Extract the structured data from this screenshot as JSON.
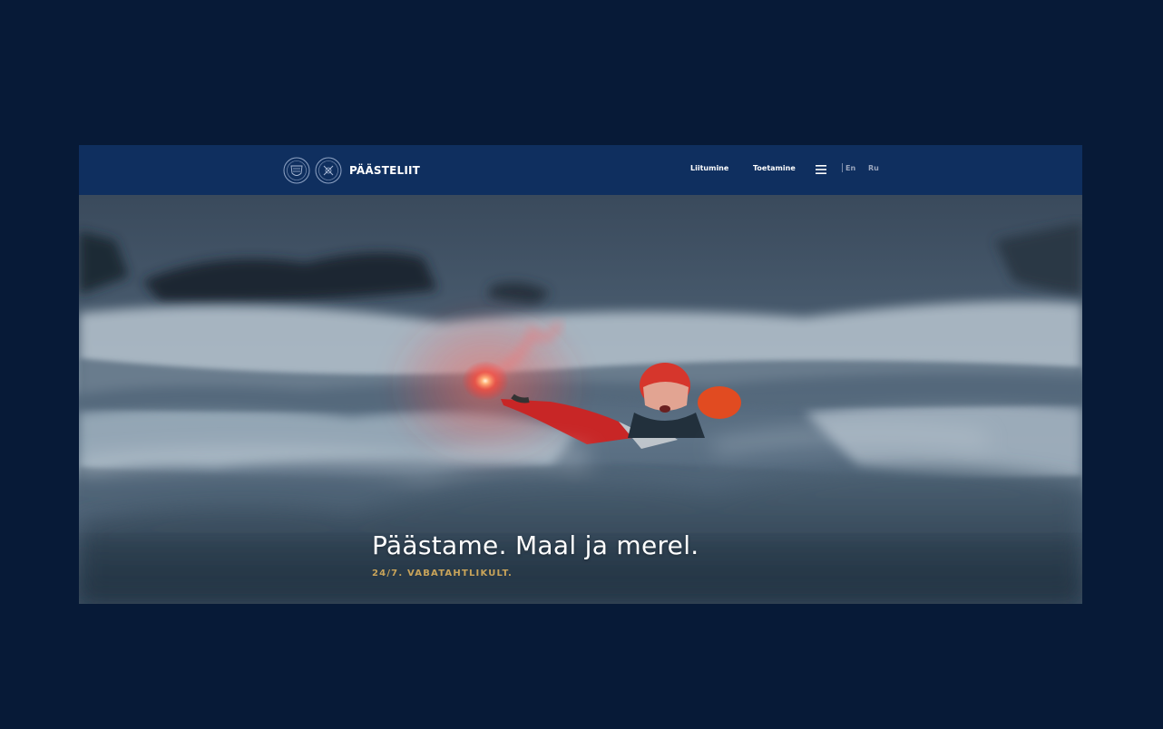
{
  "header": {
    "brand": "PÄÄSTELIIT",
    "nav": [
      {
        "label": "Liitumine"
      },
      {
        "label": "Toetamine"
      }
    ],
    "menu_icon": "hamburger-menu-icon",
    "languages": [
      "En",
      "Ru"
    ]
  },
  "hero": {
    "title": "Päästame. Maal ja merel.",
    "subtitle": "24/7. VABATAHTLIKULT."
  },
  "colors": {
    "page_background": "#071a37",
    "navbar": "#0f2f5f",
    "accent": "#c9a45a",
    "text": "#ffffff"
  }
}
